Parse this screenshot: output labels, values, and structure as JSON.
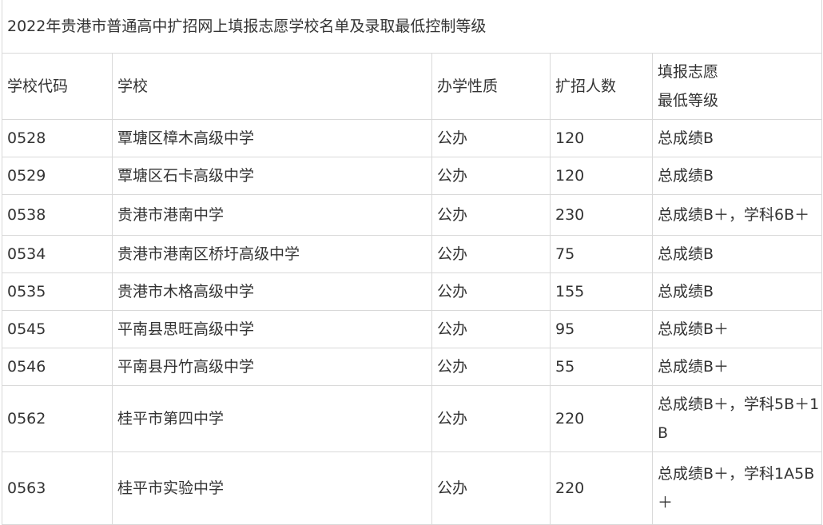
{
  "title": "2022年贵港市普通高中扩招网上填报志愿学校名单及录取最低控制等级",
  "columns": [
    "学校代码",
    "学校",
    "办学性质",
    "扩招人数",
    "填报志愿\n最低等级"
  ],
  "rows": [
    {
      "code": "0528",
      "school": "覃塘区樟木高级中学",
      "type": "公办",
      "count": "120",
      "grade": "总成绩B"
    },
    {
      "code": "0529",
      "school": "覃塘区石卡高级中学",
      "type": "公办",
      "count": "120",
      "grade": "总成绩B"
    },
    {
      "code": "0538",
      "school": "贵港市港南中学",
      "type": "公办",
      "count": "230",
      "grade": "总成绩B＋，学科6B＋"
    },
    {
      "code": "0534",
      "school": "贵港市港南区桥圩高级中学",
      "type": "公办",
      "count": "75",
      "grade": "总成绩B"
    },
    {
      "code": "0535",
      "school": "贵港市木格高级中学",
      "type": "公办",
      "count": "155",
      "grade": "总成绩B"
    },
    {
      "code": "0545",
      "school": "平南县思旺高级中学",
      "type": "公办",
      "count": "95",
      "grade": "总成绩B＋"
    },
    {
      "code": "0546",
      "school": "平南县丹竹高级中学",
      "type": "公办",
      "count": "55",
      "grade": "总成绩B＋"
    },
    {
      "code": "0562",
      "school": "桂平市第四中学",
      "type": "公办",
      "count": "220",
      "grade": "总成绩B＋，学科5B＋1B"
    },
    {
      "code": "0563",
      "school": "桂平市实验中学",
      "type": "公办",
      "count": "220",
      "grade": "总成绩B＋，学科1A5B＋"
    }
  ]
}
